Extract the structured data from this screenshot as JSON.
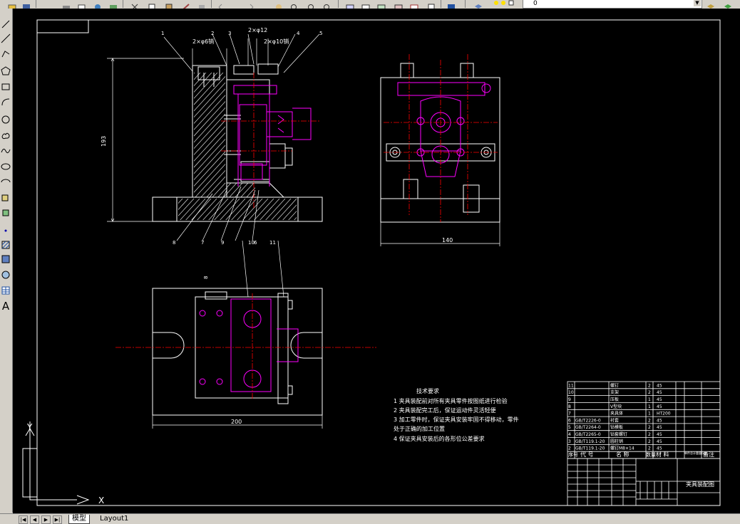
{
  "toolbar": {
    "layer_value": "0"
  },
  "left_toolbar": {
    "text_tool_label": "A"
  },
  "tabs": {
    "model": "模型",
    "layout1": "Layout1"
  },
  "drawing": {
    "ucs_y": "Y",
    "ucs_x": "X",
    "dims": {
      "height": "193",
      "width_top_right": "140",
      "width_plan": "200",
      "top_a": "2×φ6销",
      "top_b": "2×φ12",
      "top_c": "2×φ10销"
    },
    "balloons": [
      "1",
      "2",
      "3",
      "4",
      "5",
      "6",
      "7",
      "8",
      "9",
      "10",
      "11",
      "8"
    ],
    "tech_title": "技术要求",
    "tech_items": [
      "1  夹具装配前对所有夹具零件按图纸进行检验",
      "2  夹具装配完工后，保证运动件灵活轻便",
      "3  加工零件时，保证夹具安装牢固不得移动，零件",
      "    处于正确的加工位置",
      "4  保证夹具安装后的各形位公差要求"
    ],
    "bom_rows": [
      {
        "no": "11",
        "code": "",
        "name": "螺钉",
        "qty": "2",
        "mat": "45"
      },
      {
        "no": "10",
        "code": "",
        "name": "支架",
        "qty": "2",
        "mat": "45"
      },
      {
        "no": "9",
        "code": "",
        "name": "压板",
        "qty": "1",
        "mat": "45"
      },
      {
        "no": "8",
        "code": "",
        "name": "V型块",
        "qty": "1",
        "mat": "45"
      },
      {
        "no": "7",
        "code": "",
        "name": "夹具体",
        "qty": "1",
        "mat": "HT200"
      },
      {
        "no": "6",
        "code": "GB/T2226-0",
        "name": "衬套",
        "qty": "2",
        "mat": "45"
      },
      {
        "no": "5",
        "code": "GB/T2264-0",
        "name": "钻模板",
        "qty": "2",
        "mat": "45"
      },
      {
        "no": "4",
        "code": "GB/T2265-0",
        "name": "钻套螺钉",
        "qty": "2",
        "mat": "45"
      },
      {
        "no": "3",
        "code": "GB/T119.1-20",
        "name": "圆柱销",
        "qty": "2",
        "mat": "45"
      },
      {
        "no": "2",
        "code": "GB/T119.1-20",
        "name": "螺钉M8×14",
        "qty": "2",
        "mat": "45"
      }
    ],
    "bom_header": {
      "no": "序号",
      "code": "代 号",
      "name": "名 称",
      "qty": "数量",
      "mat": "材 料",
      "weight": "单件总计重量(kg)",
      "note": "备注"
    },
    "title_name": "夹具装配图"
  },
  "colors": {
    "canvas_bg": "#000000",
    "line": "#ffffff",
    "center": "#ff0000",
    "part": "#ff00ff",
    "dim": "#00ffff"
  }
}
